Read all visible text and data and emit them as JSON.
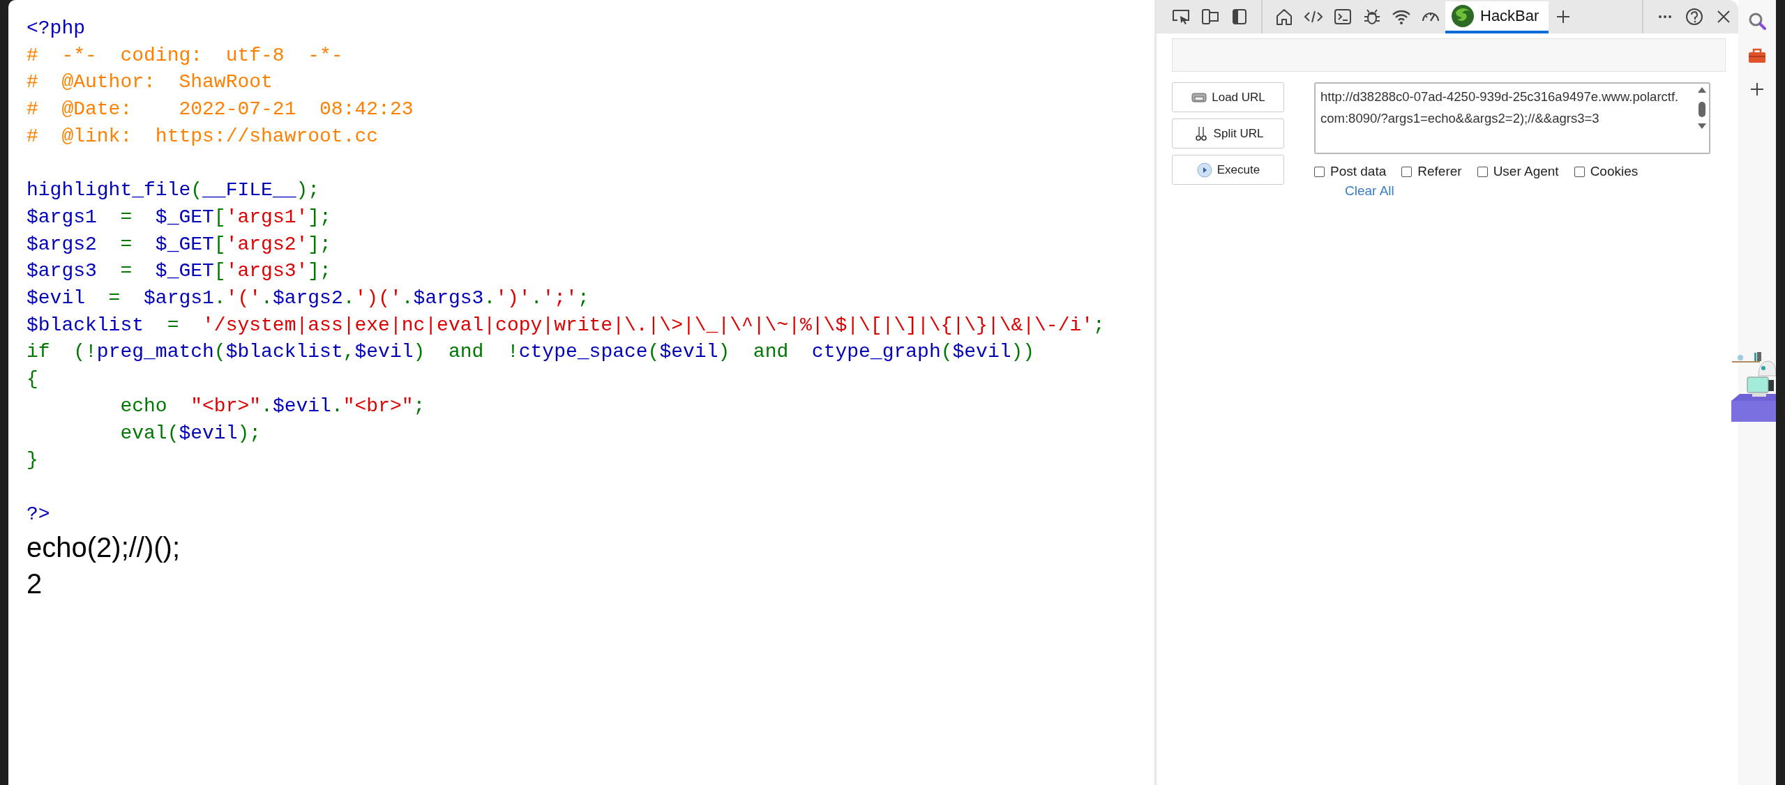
{
  "page": {
    "code_lines": [
      {
        "tokens": [
          {
            "text": "<?php",
            "kind": "default"
          }
        ]
      },
      {
        "tokens": [
          {
            "text": "#  -*-  coding:  utf-8  -*-",
            "kind": "comment"
          }
        ]
      },
      {
        "tokens": [
          {
            "text": "#  @Author:  ShawRoot",
            "kind": "comment"
          }
        ]
      },
      {
        "tokens": [
          {
            "text": "#  @Date:    2022-07-21  08:42:23",
            "kind": "comment"
          }
        ]
      },
      {
        "tokens": [
          {
            "text": "#  @link:  https://shawroot.cc",
            "kind": "comment"
          }
        ]
      },
      {
        "kind": "blank"
      },
      {
        "tokens": [
          {
            "text": "highlight_file",
            "kind": "default"
          },
          {
            "text": "(",
            "kind": "keyword"
          },
          {
            "text": "__FILE__",
            "kind": "default"
          },
          {
            "text": ");",
            "kind": "keyword"
          }
        ]
      },
      {
        "tokens": [
          {
            "text": "$args1",
            "kind": "default"
          },
          {
            "text": "  =  ",
            "kind": "keyword"
          },
          {
            "text": "$_GET",
            "kind": "default"
          },
          {
            "text": "[",
            "kind": "keyword"
          },
          {
            "text": "'args1'",
            "kind": "string"
          },
          {
            "text": "];",
            "kind": "keyword"
          }
        ]
      },
      {
        "tokens": [
          {
            "text": "$args2",
            "kind": "default"
          },
          {
            "text": "  =  ",
            "kind": "keyword"
          },
          {
            "text": "$_GET",
            "kind": "default"
          },
          {
            "text": "[",
            "kind": "keyword"
          },
          {
            "text": "'args2'",
            "kind": "string"
          },
          {
            "text": "];",
            "kind": "keyword"
          }
        ]
      },
      {
        "tokens": [
          {
            "text": "$args3",
            "kind": "default"
          },
          {
            "text": "  =  ",
            "kind": "keyword"
          },
          {
            "text": "$_GET",
            "kind": "default"
          },
          {
            "text": "[",
            "kind": "keyword"
          },
          {
            "text": "'args3'",
            "kind": "string"
          },
          {
            "text": "];",
            "kind": "keyword"
          }
        ]
      },
      {
        "tokens": [
          {
            "text": "$evil",
            "kind": "default"
          },
          {
            "text": "  =  ",
            "kind": "keyword"
          },
          {
            "text": "$args1",
            "kind": "default"
          },
          {
            "text": ".",
            "kind": "keyword"
          },
          {
            "text": "'('",
            "kind": "string"
          },
          {
            "text": ".",
            "kind": "keyword"
          },
          {
            "text": "$args2",
            "kind": "default"
          },
          {
            "text": ".",
            "kind": "keyword"
          },
          {
            "text": "')('",
            "kind": "string"
          },
          {
            "text": ".",
            "kind": "keyword"
          },
          {
            "text": "$args3",
            "kind": "default"
          },
          {
            "text": ".",
            "kind": "keyword"
          },
          {
            "text": "')'",
            "kind": "string"
          },
          {
            "text": ".",
            "kind": "keyword"
          },
          {
            "text": "';'",
            "kind": "string"
          },
          {
            "text": ";",
            "kind": "keyword"
          }
        ]
      },
      {
        "tokens": [
          {
            "text": "$blacklist",
            "kind": "default"
          },
          {
            "text": "  =  ",
            "kind": "keyword"
          },
          {
            "text": "'/system|ass|exe|nc|eval|copy|write|\\.|\\>|\\_|\\^|\\~|%|\\$|\\[|\\]|\\{|\\}|\\&|\\-/i'",
            "kind": "string"
          },
          {
            "text": ";",
            "kind": "keyword"
          }
        ]
      },
      {
        "tokens": [
          {
            "text": "if  (!",
            "kind": "keyword"
          },
          {
            "text": "preg_match",
            "kind": "default"
          },
          {
            "text": "(",
            "kind": "keyword"
          },
          {
            "text": "$blacklist",
            "kind": "default"
          },
          {
            "text": ",",
            "kind": "keyword"
          },
          {
            "text": "$evil",
            "kind": "default"
          },
          {
            "text": ")  and  !",
            "kind": "keyword"
          },
          {
            "text": "ctype_space",
            "kind": "default"
          },
          {
            "text": "(",
            "kind": "keyword"
          },
          {
            "text": "$evil",
            "kind": "default"
          },
          {
            "text": ")  and  ",
            "kind": "keyword"
          },
          {
            "text": "ctype_graph",
            "kind": "default"
          },
          {
            "text": "(",
            "kind": "keyword"
          },
          {
            "text": "$evil",
            "kind": "default"
          },
          {
            "text": "))",
            "kind": "keyword"
          }
        ]
      },
      {
        "tokens": [
          {
            "text": "{",
            "kind": "keyword"
          }
        ]
      },
      {
        "tokens": [
          {
            "text": "        echo  ",
            "kind": "keyword"
          },
          {
            "text": "\"<br>\"",
            "kind": "string"
          },
          {
            "text": ".",
            "kind": "keyword"
          },
          {
            "text": "$evil",
            "kind": "default"
          },
          {
            "text": ".",
            "kind": "keyword"
          },
          {
            "text": "\"<br>\"",
            "kind": "string"
          },
          {
            "text": ";",
            "kind": "keyword"
          }
        ]
      },
      {
        "tokens": [
          {
            "text": "        eval(",
            "kind": "keyword"
          },
          {
            "text": "$evil",
            "kind": "default"
          },
          {
            "text": ");",
            "kind": "keyword"
          }
        ]
      },
      {
        "tokens": [
          {
            "text": "}",
            "kind": "keyword"
          }
        ]
      },
      {
        "kind": "blank"
      },
      {
        "tokens": [
          {
            "text": "?>",
            "kind": "default"
          }
        ]
      }
    ],
    "output": [
      "echo(2);//)();",
      "2"
    ]
  },
  "devtools": {
    "tabs": [
      {
        "selected": false
      },
      {
        "selected": false
      },
      {
        "selected": false
      },
      {
        "selected": false
      },
      {
        "selected": false
      },
      {
        "selected": false
      },
      {
        "label": "HackBar",
        "selected": true
      }
    ],
    "hackbar": {
      "buttons": [
        "Load URL",
        "Split URL",
        "Execute"
      ],
      "url": "http://d38288c0-07ad-4250-939d-25c316a9497e.www.polarctf.com:8090/?args1=echo&&args2=2);//&&agrs3=3",
      "options": [
        {
          "label": "Post data",
          "checked": false
        },
        {
          "label": "Referer",
          "checked": false
        },
        {
          "label": "User Agent",
          "checked": false
        },
        {
          "label": "Cookies",
          "checked": false
        }
      ],
      "clear_all": "Clear All"
    }
  }
}
